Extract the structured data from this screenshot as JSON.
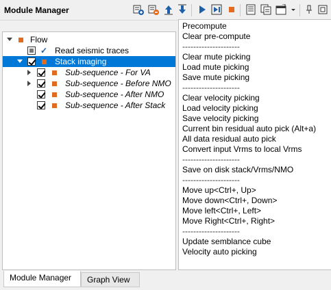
{
  "window": {
    "title": "Module Manager"
  },
  "toolbar": {
    "buttons": [
      {
        "icon": "add-module-icon"
      },
      {
        "icon": "remove-module-icon"
      },
      {
        "icon": "move-up-icon"
      },
      {
        "icon": "move-down-icon"
      },
      {
        "icon": "play-icon"
      },
      {
        "icon": "run-to-icon"
      },
      {
        "icon": "stop-icon"
      },
      {
        "icon": "list-icon"
      },
      {
        "icon": "copy-icon"
      },
      {
        "icon": "window-icon"
      },
      {
        "icon": "dropdown-icon"
      },
      {
        "icon": "pin-icon"
      },
      {
        "icon": "float-icon"
      }
    ],
    "colors": {
      "accent_blue": "#1f5fa8",
      "stop_orange": "#e46a1e"
    }
  },
  "tree": {
    "items": [
      {
        "label": "Flow",
        "level": 0,
        "expanded": true
      },
      {
        "label": "Read seismic traces",
        "level": 1,
        "check": "indeterminate"
      },
      {
        "label": "Stack imaging",
        "level": 1,
        "check": "checked",
        "selected": true,
        "expanded": true
      },
      {
        "label": "Sub-sequence - For VA",
        "level": 2,
        "check": "checked",
        "italic": true,
        "collapsed": true
      },
      {
        "label": "Sub-sequence - Before NMO",
        "level": 2,
        "check": "checked",
        "italic": true,
        "collapsed": true
      },
      {
        "label": "Sub-sequence - After NMO",
        "level": 2,
        "check": "checked",
        "italic": true
      },
      {
        "label": "Sub-sequence - After Stack",
        "level": 2,
        "check": "checked",
        "italic": true
      }
    ],
    "colors": {
      "selection": "#0078d7",
      "module_marker": "#e46a1e"
    }
  },
  "menu": {
    "items": [
      "Precompute",
      "Clear pre-compute",
      "---------------------",
      "Clear mute picking",
      "Load mute picking",
      "Save mute picking",
      "---------------------",
      "Clear velocity picking",
      "Load velocity picking",
      "Save velocity picking",
      "Current bin residual auto pick (Alt+a)",
      "All data residual auto pick",
      "Convert input Vrms to local Vrms",
      "---------------------",
      "Save on disk stack/Vrms/NMO",
      "---------------------",
      "Move up<Ctrl+, Up>",
      "Move down<Ctrl+, Down>",
      "Move left<Ctrl+, Left>",
      "Move Right<Ctrl+, Right>",
      "---------------------",
      "Update semblance cube",
      "Velocity auto picking"
    ]
  },
  "tabs": [
    {
      "label": "Module Manager",
      "active": true
    },
    {
      "label": "Graph View",
      "active": false
    }
  ]
}
